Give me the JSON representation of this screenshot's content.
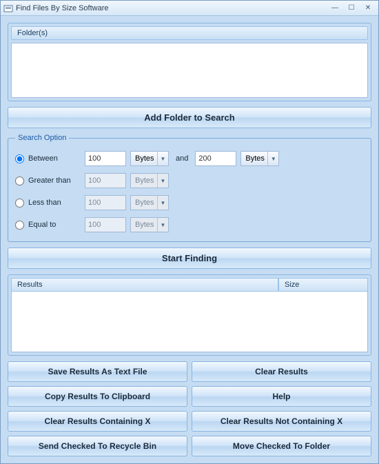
{
  "window": {
    "title": "Find Files By Size Software"
  },
  "folders": {
    "header": "Folder(s)"
  },
  "addFolderBtn": "Add Folder to Search",
  "searchOption": {
    "legend": "Search Option",
    "rows": {
      "between": {
        "label": "Between",
        "val1": "100",
        "unit1": "Bytes",
        "and": "and",
        "val2": "200",
        "unit2": "Bytes"
      },
      "greater": {
        "label": "Greater than",
        "val": "100",
        "unit": "Bytes"
      },
      "less": {
        "label": "Less than",
        "val": "100",
        "unit": "Bytes"
      },
      "equal": {
        "label": "Equal to",
        "val": "100",
        "unit": "Bytes"
      }
    }
  },
  "startBtn": "Start Finding",
  "results": {
    "colResults": "Results",
    "colSize": "Size"
  },
  "buttons": {
    "saveText": "Save Results As Text File",
    "clear": "Clear Results",
    "copy": "Copy Results To Clipboard",
    "help": "Help",
    "clearContain": "Clear Results Containing X",
    "clearNotContain": "Clear Results Not Containing X",
    "recycle": "Send Checked To Recycle Bin",
    "move": "Move Checked To Folder"
  }
}
